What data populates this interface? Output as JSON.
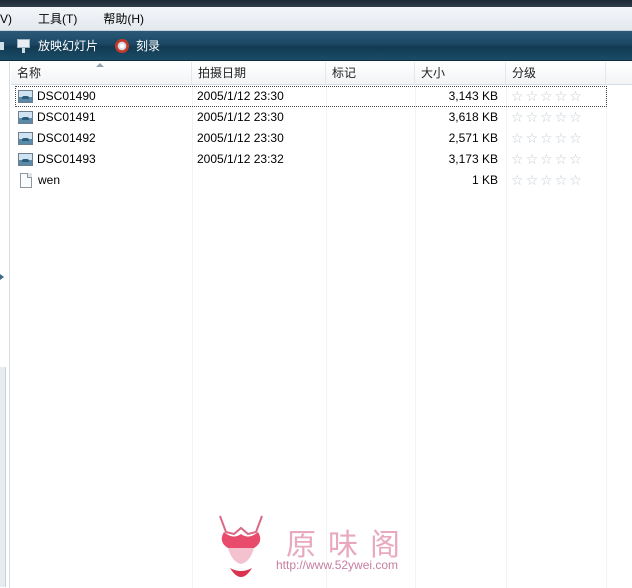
{
  "menu": {
    "items": [
      "V)",
      "工具(T)",
      "帮助(H)"
    ]
  },
  "toolbar": {
    "slideshow_label": "放映幻灯片",
    "burn_label": "刻录"
  },
  "columns": {
    "name": "名称",
    "date": "拍摄日期",
    "tags": "标记",
    "size": "大小",
    "rating": "分级"
  },
  "files": [
    {
      "name": "DSC01490",
      "date": "2005/1/12 23:30",
      "size": "3,143 KB",
      "type": "image",
      "selected": true
    },
    {
      "name": "DSC01491",
      "date": "2005/1/12 23:30",
      "size": "3,618 KB",
      "type": "image",
      "selected": false
    },
    {
      "name": "DSC01492",
      "date": "2005/1/12 23:30",
      "size": "2,571 KB",
      "type": "image",
      "selected": false
    },
    {
      "name": "DSC01493",
      "date": "2005/1/12 23:32",
      "size": "3,173 KB",
      "type": "image",
      "selected": false
    },
    {
      "name": "wen",
      "date": "",
      "size": "1 KB",
      "type": "text",
      "selected": false
    }
  ],
  "rating_stars": 5,
  "watermark": {
    "text": "原味阁",
    "url": "http://www.52ywei.com"
  },
  "colors": {
    "toolbar": "#1b4763",
    "selection_outline": "#4b4b4b",
    "watermark": "#e9a9bd"
  }
}
